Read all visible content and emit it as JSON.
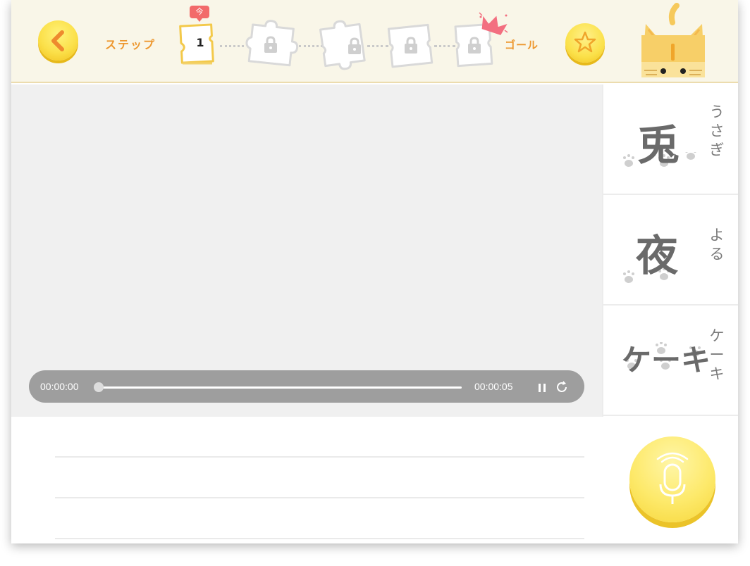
{
  "header": {
    "step_label": "ステップ",
    "current_step": "1",
    "now_badge": "今",
    "goal_label": "ゴール"
  },
  "player": {
    "current_time": "00:00:00",
    "total_time": "00:00:05",
    "progress": 0
  },
  "cards": [
    {
      "word": "兎",
      "reading": [
        "う",
        "さ",
        "ぎ"
      ]
    },
    {
      "word": "夜",
      "reading": [
        "よ",
        "る"
      ]
    },
    {
      "word": "ケーキ",
      "reading": [
        "ケ",
        "ー",
        "キ"
      ]
    }
  ],
  "icons": {
    "back": "chevron-left-icon",
    "star": "star-icon",
    "lock": "lock-icon",
    "crown": "crown-icon",
    "mascot": "cat-icon",
    "pause": "pause-icon",
    "replay": "replay-icon",
    "mic": "microphone-icon"
  },
  "colors": {
    "accent_orange": "#ed9830",
    "button_yellow": "#fbe04a",
    "header_bg": "#f9f6e8",
    "badge_red": "#f26a6a",
    "video_bg": "#f0f0f0",
    "controls_bg": "#9e9e9e"
  }
}
